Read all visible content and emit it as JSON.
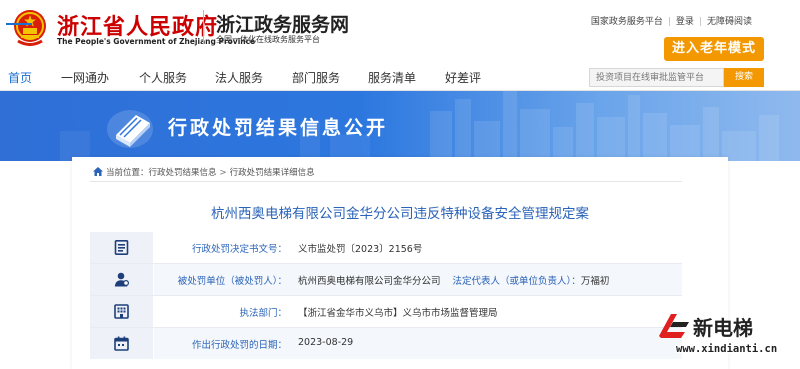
{
  "header": {
    "gov_name_cn": "浙江省人民政府",
    "gov_name_en": "The People's Government of Zhejiang Province",
    "service_name": "浙江政务服务网",
    "service_sub": "全国一体化在线政务服务平台",
    "top_links": [
      "国家政务服务平台",
      "登录",
      "无障碍阅读"
    ],
    "elder_mode": "进入老年模式"
  },
  "nav": {
    "items": [
      "首页",
      "一网通办",
      "个人服务",
      "法人服务",
      "部门服务",
      "服务清单",
      "好差评"
    ],
    "active_index": 0
  },
  "search": {
    "placeholder": "投资项目在线审批监管平台",
    "button": "搜索"
  },
  "banner": {
    "title": "行政处罚结果信息公开"
  },
  "breadcrumb": {
    "prefix": "当前位置：",
    "items": [
      "行政处罚结果信息",
      "行政处罚结果详细信息"
    ]
  },
  "doc": {
    "title": "杭州西奥电梯有限公司金华分公司违反特种设备安全管理规定案",
    "rows": [
      {
        "icon": "document-list-icon",
        "key": "行政处罚决定书文号：",
        "value": "义市监处罚〔2023〕2156号"
      },
      {
        "icon": "person-icon",
        "key": "被处罚单位（被处罚人）：",
        "value": "杭州西奥电梯有限公司金华分公司",
        "key2": "法定代表人（或单位负责人）：",
        "value2": "万福初"
      },
      {
        "icon": "building-icon",
        "key": "执法部门：",
        "value": "【浙江省金华市义乌市】义乌市市场监督管理局"
      },
      {
        "icon": "calendar-icon",
        "key": "作出行政处罚的日期：",
        "value": "2023-08-29"
      }
    ]
  },
  "watermark": {
    "name": "新电梯",
    "url": "www.xindianti.cn"
  },
  "colors": {
    "brand_red": "#cc0000",
    "accent_orange": "#f39800",
    "link_blue": "#2a63b8",
    "banner_blue": "#2c77df"
  }
}
